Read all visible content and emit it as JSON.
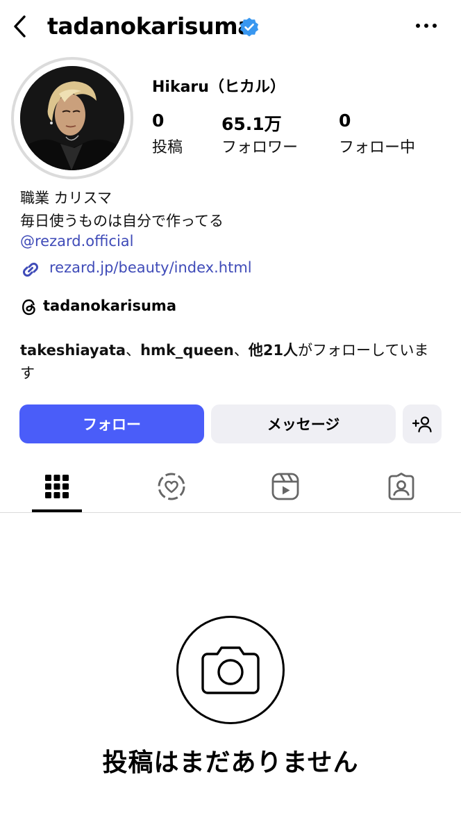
{
  "header": {
    "username": "tadanokarisuma",
    "verified_color": "#3897f0"
  },
  "profile": {
    "display_name": "Hikaru（ヒカル）",
    "stats": [
      {
        "value": "0",
        "label": "投稿"
      },
      {
        "value": "65.1万",
        "label": "フォロワー"
      },
      {
        "value": "0",
        "label": "フォロー中"
      }
    ],
    "bio": {
      "line1": "職業 カリスマ",
      "line2": "毎日使うものは自分で作ってる",
      "mention": "@rezard.official"
    },
    "link": "rezard.jp/beauty/index.html",
    "threads_username": "tadanokarisuma",
    "followed_by": {
      "user1": "takeshiayata",
      "sep1": "、",
      "user2": "hmk_queen",
      "sep2": "、",
      "others": "他21人",
      "suffix": "がフォローしています"
    }
  },
  "actions": {
    "follow_label": "フォロー",
    "message_label": "メッセージ",
    "follow_color": "#4a5df9"
  },
  "tabs": [
    {
      "icon": "grid-icon",
      "active": true
    },
    {
      "icon": "featured-icon",
      "active": false
    },
    {
      "icon": "reels-icon",
      "active": false
    },
    {
      "icon": "tagged-icon",
      "active": false
    }
  ],
  "empty_state": {
    "icon": "camera-icon",
    "text": "投稿はまだありません"
  }
}
